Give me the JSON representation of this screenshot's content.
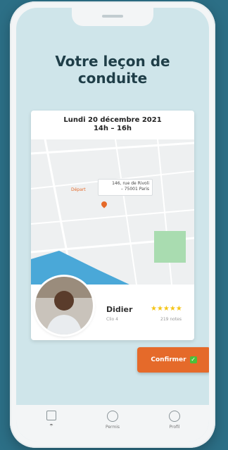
{
  "title": "Votre leçon de\nconduite",
  "lesson": {
    "date": "Lundi 20 décembre 2021",
    "time": "14h  – 16h"
  },
  "map": {
    "start_label": "Départ",
    "address_line1": "146, rue de Rivoli",
    "address_line2": "– 75001 Paris"
  },
  "instructor": {
    "name": "Didier",
    "subtitle": "Clio 4",
    "stars": "★★★★★",
    "notes": "219 notes"
  },
  "confirm_button": {
    "label": "Confirmer",
    "icon": "check-icon"
  },
  "tabs": [
    {
      "label": "☂",
      "icon": "home-icon"
    },
    {
      "label": "Permis",
      "icon": "permit-icon"
    },
    {
      "label": "Profil",
      "icon": "profile-icon"
    }
  ],
  "colors": {
    "accent": "#e56a2a",
    "background": "#cfe5ea",
    "frame": "#2c6f86"
  }
}
